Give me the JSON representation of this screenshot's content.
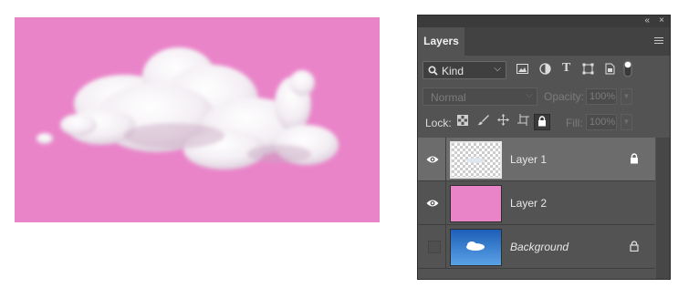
{
  "canvas": {
    "background": "#ea84c9",
    "cloud_color": "#ffffff"
  },
  "panel": {
    "header_controls": {
      "collapse": "«",
      "close": "×"
    },
    "tab": "Layers",
    "filter": {
      "kind_label": "Kind"
    },
    "blend": {
      "mode": "Normal",
      "opacity_label": "Opacity:",
      "opacity_value": "100%"
    },
    "lock": {
      "label": "Lock:",
      "fill_label": "Fill:",
      "fill_value": "100%"
    },
    "layers": [
      {
        "name": "Layer 1",
        "visible": true,
        "selected": true,
        "locked": true,
        "thumbnail": "transparent-cloud"
      },
      {
        "name": "Layer 2",
        "visible": true,
        "selected": false,
        "locked": false,
        "thumbnail": "pink-fill"
      },
      {
        "name": "Background",
        "visible": false,
        "selected": false,
        "locked": true,
        "thumbnail": "sky-cloud"
      }
    ]
  },
  "colors": {
    "panel_bg": "#535353",
    "selected_row": "#6c6c6c",
    "pink": "#ea84c9"
  }
}
